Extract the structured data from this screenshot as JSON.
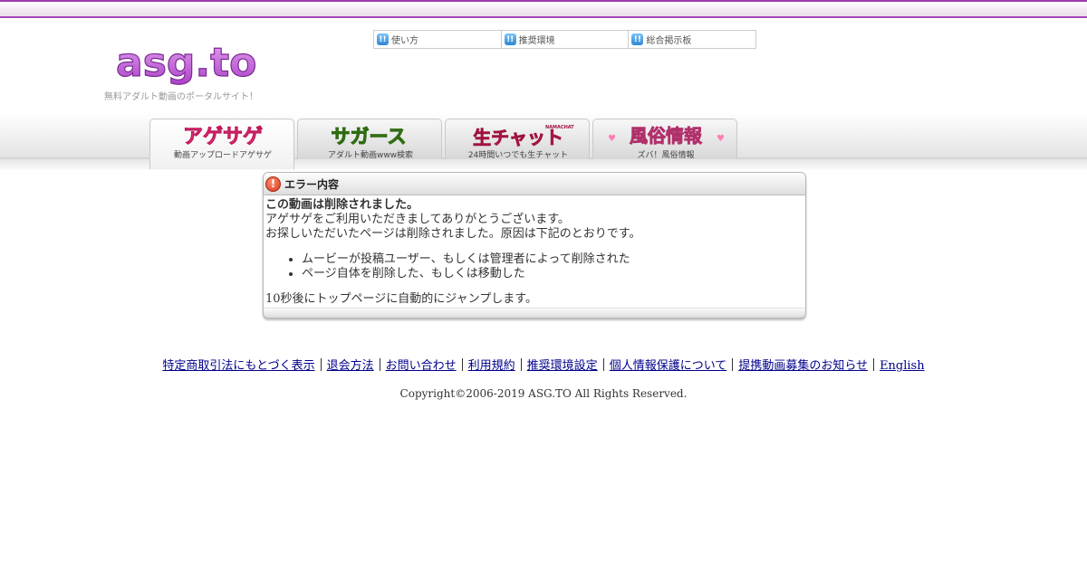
{
  "header": {
    "logo_text": "asg.to",
    "tagline": "無料アダルト動画のポータルサイト！",
    "util_links": [
      {
        "label": "使い方",
        "icon": "exclamation-badge-icon"
      },
      {
        "label": "推奨環境",
        "icon": "exclamation-badge-icon"
      },
      {
        "label": "総合掲示板",
        "icon": "exclamation-badge-icon"
      }
    ]
  },
  "tabs": [
    {
      "logo": "アゲサゲ",
      "sub": "動画アップロードアゲサゲ",
      "active": true
    },
    {
      "logo": "サガース",
      "sub": "アダルト動画www検索",
      "active": false
    },
    {
      "logo": "生チャット",
      "logo_small": "NAMACHAT",
      "sub": "24時間いつでも生チャット",
      "active": false
    },
    {
      "logo": "風俗情報",
      "sub": "ズバ！風俗情報",
      "active": false
    }
  ],
  "error": {
    "title": "エラー内容",
    "headline": "この動画は削除されました。",
    "line1": "アゲサゲをご利用いただきましてありがとうございます。",
    "line2": "お探しいただいたページは削除されました。原因は下記のとおりです。",
    "reasons": [
      "ムービーが投稿ユーザー、もしくは管理者によって削除された",
      "ページ自体を削除した、もしくは移動した"
    ],
    "redirect_note": "10秒後にトップページに自動的にジャンプします。"
  },
  "footer": {
    "links": [
      "特定商取引法にもとづく表示",
      "退会方法",
      "お問い合わせ",
      "利用規約",
      "推奨環境設定",
      "個人情報保護について",
      "提携動画募集のお知らせ",
      "English"
    ],
    "copyright": "Copyright©2006-2019 ASG.TO All Rights Reserved."
  },
  "colors": {
    "brand_purple": "#a447b6",
    "link_blue": "#00008b",
    "error_red": "#d43c1f"
  }
}
